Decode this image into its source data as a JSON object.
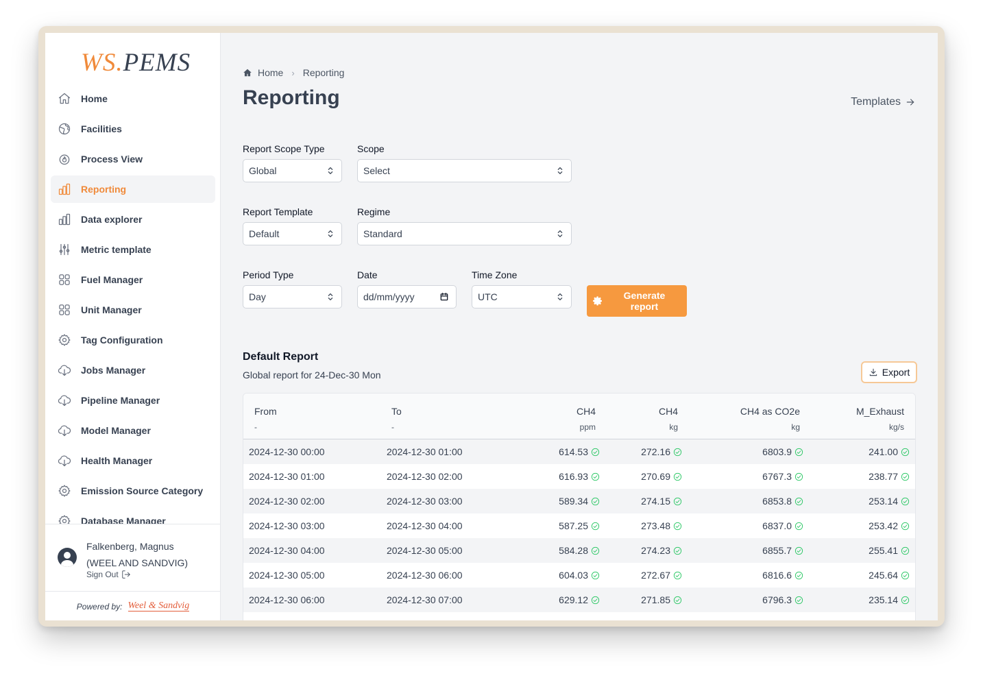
{
  "app": {
    "logo_ws": "WS",
    "logo_dot": ".",
    "logo_pems": "PEMS"
  },
  "sidebar": {
    "items": [
      {
        "label": "Home",
        "icon": "home-icon"
      },
      {
        "label": "Facilities",
        "icon": "globe-icon"
      },
      {
        "label": "Process View",
        "icon": "flame-icon"
      },
      {
        "label": "Reporting",
        "icon": "bar-chart-icon",
        "active": true
      },
      {
        "label": "Data explorer",
        "icon": "bar-chart-icon"
      },
      {
        "label": "Metric template",
        "icon": "sliders-icon"
      },
      {
        "label": "Fuel Manager",
        "icon": "grid-icon"
      },
      {
        "label": "Unit Manager",
        "icon": "grid-icon"
      },
      {
        "label": "Tag Configuration",
        "icon": "gear-icon"
      },
      {
        "label": "Jobs Manager",
        "icon": "cloud-download-icon"
      },
      {
        "label": "Pipeline Manager",
        "icon": "cloud-download-icon"
      },
      {
        "label": "Model Manager",
        "icon": "cloud-download-icon"
      },
      {
        "label": "Health Manager",
        "icon": "cloud-download-icon"
      },
      {
        "label": "Emission Source Category",
        "icon": "gear-icon"
      },
      {
        "label": "Database Manager",
        "icon": "gear-icon"
      }
    ]
  },
  "user": {
    "name": "Falkenberg, Magnus",
    "org": "(WEEL AND SANDVIG)",
    "sign_out": "Sign Out"
  },
  "footer": {
    "powered_by": "Powered by:",
    "brand": "Weel & Sandvig"
  },
  "breadcrumb": {
    "home": "Home",
    "current": "Reporting"
  },
  "page": {
    "title": "Reporting",
    "templates_link": "Templates"
  },
  "form": {
    "scope_type": {
      "label": "Report Scope Type",
      "value": "Global"
    },
    "scope": {
      "label": "Scope",
      "value": "Select"
    },
    "template": {
      "label": "Report Template",
      "value": "Default"
    },
    "regime": {
      "label": "Regime",
      "value": "Standard"
    },
    "period_type": {
      "label": "Period Type",
      "value": "Day"
    },
    "date": {
      "label": "Date",
      "placeholder": "dd/mm/yyyy"
    },
    "time_zone": {
      "label": "Time Zone",
      "value": "UTC"
    },
    "generate_label": "Generate report"
  },
  "report": {
    "title": "Default Report",
    "subtitle": "Global report for 24-Dec-30 Mon",
    "export_label": "Export",
    "columns": [
      {
        "name": "From",
        "unit": "-"
      },
      {
        "name": "To",
        "unit": "-"
      },
      {
        "name": "CH4",
        "unit": "ppm"
      },
      {
        "name": "CH4",
        "unit": "kg"
      },
      {
        "name": "CH4 as CO2e",
        "unit": "kg"
      },
      {
        "name": "M_Exhaust",
        "unit": "kg/s"
      }
    ],
    "rows": [
      [
        "2024-12-30 00:00",
        "2024-12-30 01:00",
        "614.53",
        "272.16",
        "6803.9",
        "241.00"
      ],
      [
        "2024-12-30 01:00",
        "2024-12-30 02:00",
        "616.93",
        "270.69",
        "6767.3",
        "238.77"
      ],
      [
        "2024-12-30 02:00",
        "2024-12-30 03:00",
        "589.34",
        "274.15",
        "6853.8",
        "253.14"
      ],
      [
        "2024-12-30 03:00",
        "2024-12-30 04:00",
        "587.25",
        "273.48",
        "6837.0",
        "253.42"
      ],
      [
        "2024-12-30 04:00",
        "2024-12-30 05:00",
        "584.28",
        "274.23",
        "6855.7",
        "255.41"
      ],
      [
        "2024-12-30 05:00",
        "2024-12-30 06:00",
        "604.03",
        "272.67",
        "6816.6",
        "245.64"
      ],
      [
        "2024-12-30 06:00",
        "2024-12-30 07:00",
        "629.12",
        "271.85",
        "6796.3",
        "235.14"
      ]
    ]
  },
  "colors": {
    "accent": "#f08a3a",
    "button": "#f6993f",
    "check": "#22c55e"
  }
}
